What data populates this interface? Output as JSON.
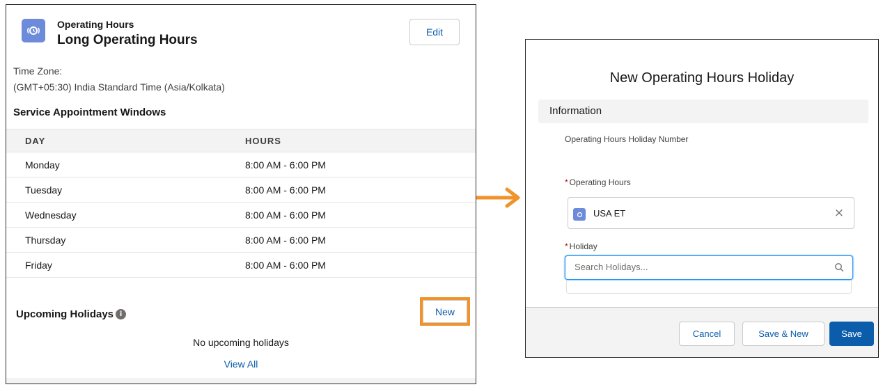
{
  "left_card": {
    "object_label": "Operating Hours",
    "title": "Long Operating Hours",
    "edit_label": "Edit",
    "timezone_label": "Time Zone:",
    "timezone_value": "(GMT+05:30) India Standard Time (Asia/Kolkata)",
    "windows_title": "Service Appointment Windows",
    "table": {
      "headers": [
        "DAY",
        "HOURS"
      ],
      "rows": [
        {
          "day": "Monday",
          "hours": "8:00 AM - 6:00 PM"
        },
        {
          "day": "Tuesday",
          "hours": "8:00 AM - 6:00 PM"
        },
        {
          "day": "Wednesday",
          "hours": "8:00 AM - 6:00 PM"
        },
        {
          "day": "Thursday",
          "hours": "8:00 AM - 6:00 PM"
        },
        {
          "day": "Friday",
          "hours": "8:00 AM - 6:00 PM"
        }
      ]
    },
    "holidays_title": "Upcoming Holidays",
    "info_icon_glyph": "i",
    "new_label": "New",
    "no_holidays_text": "No upcoming holidays",
    "view_all_label": "View All"
  },
  "modal": {
    "title": "New Operating Hours Holiday",
    "section": "Information",
    "number_label": "Operating Hours Holiday Number",
    "required_mark": "*",
    "operating_hours_label": "Operating Hours",
    "operating_hours_value": "USA ET",
    "clear_glyph": "×",
    "holiday_label": "Holiday",
    "holiday_placeholder": "Search Holidays...",
    "cancel_label": "Cancel",
    "save_new_label": "Save & New",
    "save_label": "Save"
  },
  "colors": {
    "brand_blue": "#0b5cab",
    "object_icon": "#6d8bdb",
    "highlight_orange": "#f0932a",
    "required_red": "#ba0517"
  },
  "icons": [
    "operating-hours-icon",
    "info-icon",
    "arrow-right-icon",
    "clear-icon",
    "search-icon"
  ]
}
